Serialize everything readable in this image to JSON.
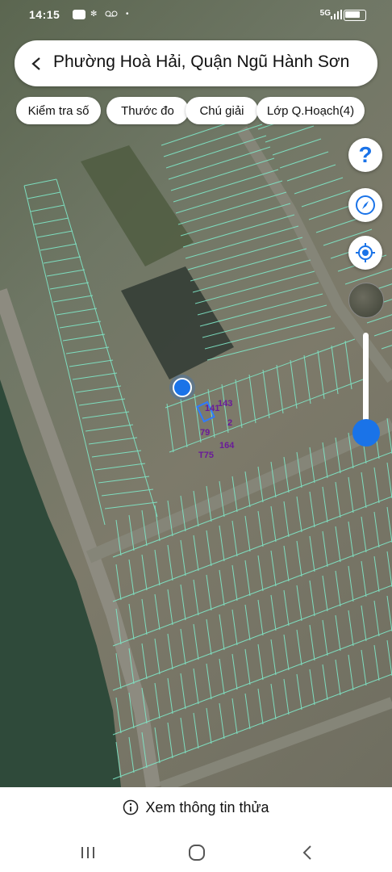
{
  "status_bar": {
    "time": "14:15",
    "icons": [
      "zalo-icon",
      "flower-icon",
      "voicemail-icon"
    ],
    "network": "5G"
  },
  "header": {
    "title": "Phường Hoà Hải, Quận Ngũ Hành Sơn"
  },
  "toolbar": {
    "chips": [
      "Kiểm tra số",
      "Thước đo",
      "Chú giải",
      "Lớp Q.Hoạch(4)"
    ]
  },
  "controls": {
    "help_label": "?",
    "zoom_level": 0.85
  },
  "parcel_labels": [
    "141",
    "143",
    "2",
    "T75",
    "164",
    "79"
  ],
  "bottom": {
    "info_label": "Xem thông tin thửa"
  },
  "colors": {
    "accent": "#1a73e8",
    "parcel_line": "#7fe8c8",
    "parcel_label": "#6a1b9a"
  }
}
